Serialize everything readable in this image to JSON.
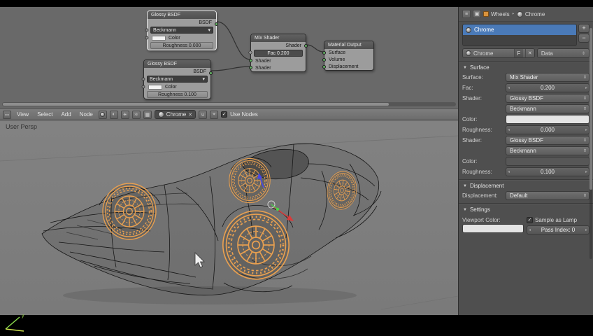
{
  "icons": {
    "check": "✓",
    "x": "✕",
    "plus": "+",
    "minus": "−",
    "tri_down": "▼",
    "chevron": "‣",
    "dd": "▾",
    "arrow_left": "◂",
    "arrow_right": "▸",
    "updown": "⇕",
    "editor_grid": "⚏",
    "pin": "⌖",
    "snap": "∪"
  },
  "node_editor": {
    "header": {
      "menus": [
        "View",
        "Select",
        "Add",
        "Node"
      ],
      "material_name": "Chrome",
      "use_nodes_label": "Use Nodes"
    },
    "glossy1": {
      "title": "Glossy BSDF",
      "out": "BSDF",
      "dist": "Beckmann",
      "color_label": "Color",
      "rough": "Roughness 0.000"
    },
    "glossy2": {
      "title": "Glossy BSDF",
      "out": "BSDF",
      "dist": "Beckmann",
      "color_label": "Color",
      "rough": "Roughness 0.100"
    },
    "mix": {
      "title": "Mix Shader",
      "out": "Shader",
      "fac": "Fac 0.200",
      "in1": "Shader",
      "in2": "Shader"
    },
    "output": {
      "title": "Material Output",
      "in_surface": "Surface",
      "in_volume": "Volume",
      "in_displacement": "Displacement"
    }
  },
  "viewport": {
    "view_label": "User Persp"
  },
  "props": {
    "breadcrumb": {
      "object": "Wheels",
      "material": "Chrome"
    },
    "slot_name": "Chrome",
    "datablock": {
      "name": "Chrome",
      "fake_user": "F",
      "data_menu": "Data"
    },
    "surface": {
      "title": "Surface",
      "surface_label": "Surface:",
      "surface_value": "Mix Shader",
      "fac_label": "Fac:",
      "fac_value": "0.200",
      "shader1_label": "Shader:",
      "shader1_value": "Glossy BSDF",
      "dist1": "Beckmann",
      "color1_label": "Color:",
      "rough1_label": "Roughness:",
      "rough1_value": "0.000",
      "shader2_label": "Shader:",
      "shader2_value": "Glossy BSDF",
      "dist2": "Beckmann",
      "color2_label": "Color:",
      "rough2_label": "Roughness:",
      "rough2_value": "0.100"
    },
    "displacement": {
      "title": "Displacement",
      "label": "Displacement:",
      "value": "Default"
    },
    "settings": {
      "title": "Settings",
      "viewport_color_label": "Viewport Color:",
      "sample_as_lamp_label": "Sample as Lamp",
      "pass_index_label": "Pass Index: 0"
    },
    "colors": {
      "slot_active_blue": "#4a7ab8",
      "selection_orange": "#e9a050"
    }
  }
}
